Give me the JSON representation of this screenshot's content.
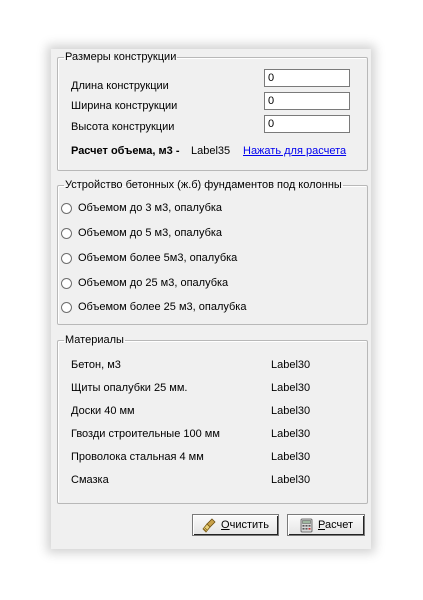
{
  "dimensions": {
    "legend": "Размеры конструкции",
    "rows": [
      {
        "label": "Длина конструкции",
        "value": "0"
      },
      {
        "label": "Ширина конструкции",
        "value": "0"
      },
      {
        "label": "Высота конструкции",
        "value": "0"
      }
    ],
    "volume_label": "Расчет объема, м3 -",
    "volume_value": "Label35",
    "calc_link": "Нажать для расчета"
  },
  "foundations": {
    "legend": "Устройство бетонных (ж.б) фундаментов под колонны",
    "options": [
      "Объемом до 3 м3, опалубка",
      "Объемом до 5 м3, опалубка",
      "Объемом более 5м3, опалубка",
      "Объемом до 25 м3, опалубка",
      "Объемом более 25 м3, опалубка"
    ]
  },
  "materials": {
    "legend": "Материалы",
    "rows": [
      {
        "name": "Бетон, м3",
        "value": "Label30"
      },
      {
        "name": "Щиты опалубки 25 мм.",
        "value": "Label30"
      },
      {
        "name": "Доски 40 мм",
        "value": "Label30"
      },
      {
        "name": "Гвозди строительные 100 мм",
        "value": "Label30"
      },
      {
        "name": "Проволока стальная 4 мм",
        "value": "Label30"
      },
      {
        "name": "Смазка",
        "value": "Label30"
      }
    ]
  },
  "buttons": {
    "clear_label": "Очистить",
    "calc_label": "Расчет"
  },
  "icons": {
    "clear": "broom-icon",
    "calc": "calculator-icon"
  }
}
